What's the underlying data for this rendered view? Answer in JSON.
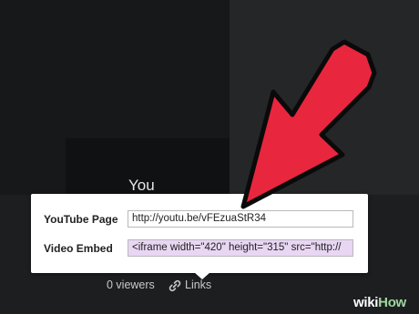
{
  "user_label": "You",
  "popup": {
    "youtube_page_label": "YouTube Page",
    "youtube_page_value": "http://youtu.be/vFEzuaStR34",
    "video_embed_label": "Video Embed",
    "video_embed_value": "<iframe width=\"420\" height=\"315\" src=\"http://"
  },
  "footer": {
    "viewers": "0 viewers",
    "links": "Links"
  },
  "watermark": {
    "wiki": "wiki",
    "how": "How"
  },
  "colors": {
    "arrow": "#e8263e",
    "selection": "#e8d6f3"
  },
  "icons": [
    "link-icon",
    "pointer-arrow"
  ]
}
